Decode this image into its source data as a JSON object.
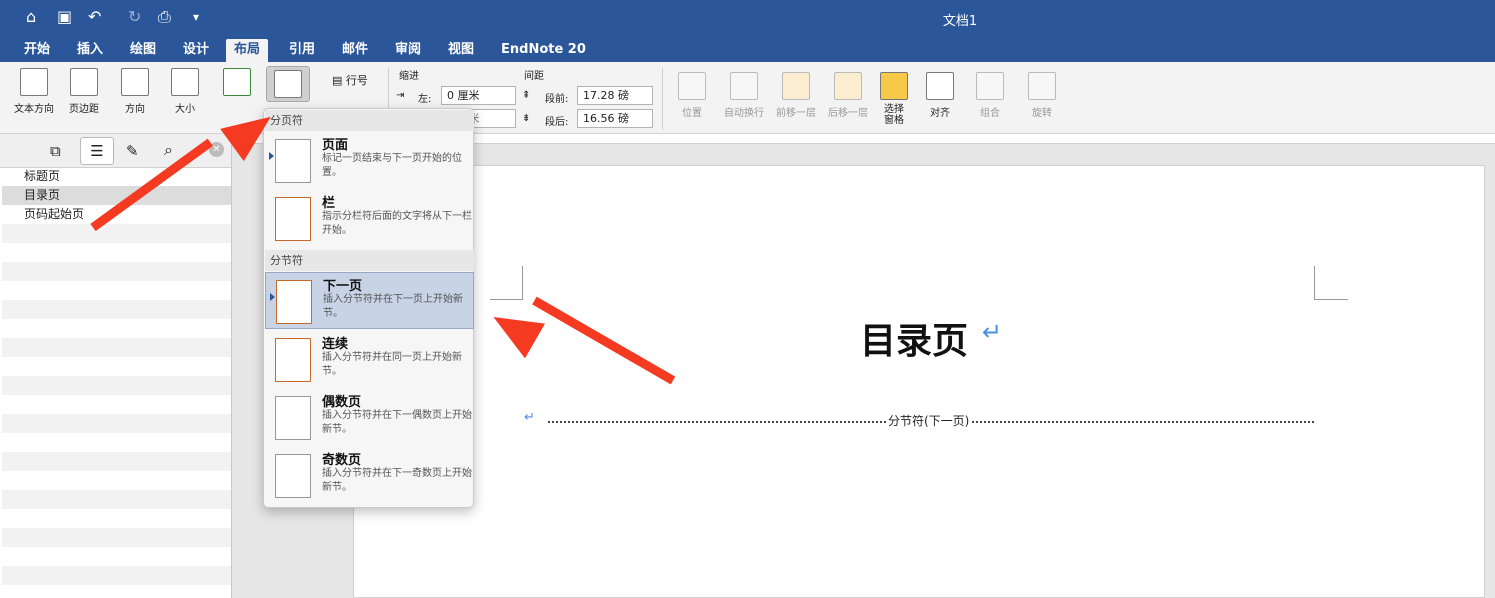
{
  "window": {
    "title": "文档1"
  },
  "quick_access": [
    "home-icon",
    "save-icon",
    "undo-icon",
    "redo-icon",
    "print-icon",
    "customize-icon"
  ],
  "tabs": [
    "开始",
    "插入",
    "绘图",
    "设计",
    "布局",
    "引用",
    "邮件",
    "审阅",
    "视图",
    "EndNote 20"
  ],
  "active_tab": "布局",
  "ribbon": {
    "text_direction": "文本方向",
    "margins": "页边距",
    "orientation": "方向",
    "size": "大小",
    "line_numbers": "行号",
    "indent_label": "缩进",
    "spacing_label": "间距",
    "left_label": "左:",
    "left_value": "0 厘米",
    "right_value": "0 厘米",
    "before_label": "段前:",
    "before_value": "17.28 磅",
    "after_label": "段后:",
    "after_value": "16.56 磅",
    "position": "位置",
    "wrap_text": "自动换行",
    "bring_forward": "前移一层",
    "send_backward": "后移一层",
    "selection_pane_1": "选择",
    "selection_pane_2": "窗格",
    "align": "对齐",
    "group": "组合",
    "rotate": "旋转"
  },
  "nav_pane": {
    "items": [
      "标题页",
      "目录页",
      "页码起始页"
    ],
    "selected": "目录页"
  },
  "document": {
    "heading": "目录页",
    "section_break": "分节符(下一页)"
  },
  "breaks_menu": {
    "page_breaks_header": "分页符",
    "section_breaks_header": "分节符",
    "items": [
      {
        "title": "页面",
        "desc": "标记一页结束与下一页开始的位置。"
      },
      {
        "title": "栏",
        "desc": "指示分栏符后面的文字将从下一栏开始。"
      },
      {
        "title": "下一页",
        "desc": "插入分节符并在下一页上开始新节。"
      },
      {
        "title": "连续",
        "desc": "插入分节符并在同一页上开始新节。"
      },
      {
        "title": "偶数页",
        "desc": "插入分节符并在下一偶数页上开始新节。"
      },
      {
        "title": "奇数页",
        "desc": "插入分节符并在下一奇数页上开始新节。"
      }
    ],
    "selected_index": 2
  },
  "colors": {
    "accent": "#2b579a",
    "annotation_arrow": "#f53a22",
    "menu_highlight": "#c8d4e6"
  }
}
